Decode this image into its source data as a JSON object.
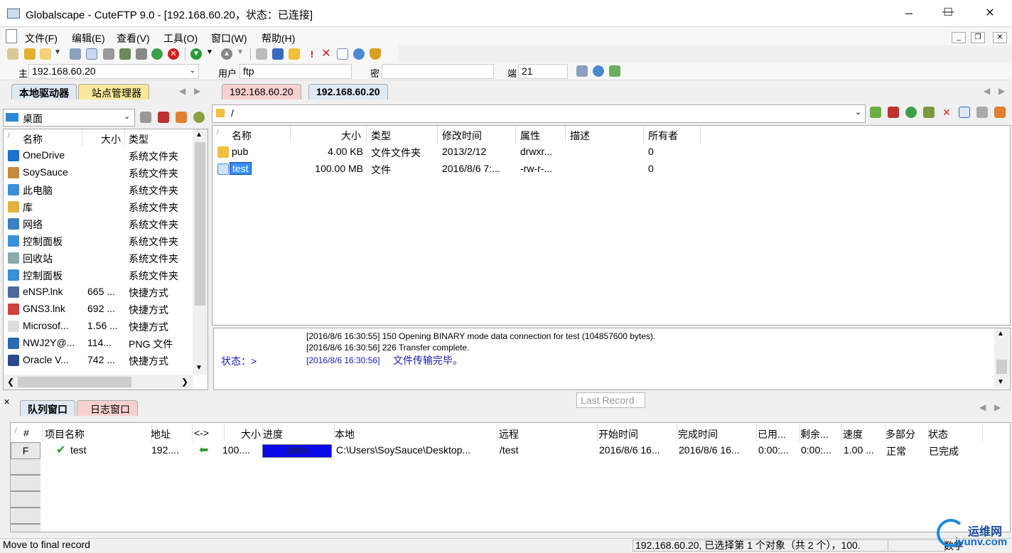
{
  "window": {
    "title": "Globalscape - CuteFTP 9.0 - [192.168.60.20，状态：已连接]"
  },
  "menu": [
    "文件(F)",
    "编辑(E)",
    "查看(V)",
    "工具(O)",
    "窗口(W)",
    "帮助(H)"
  ],
  "quickconnect": {
    "host_label": "主",
    "host": "192.168.60.20",
    "user_label": "用户",
    "user": "ftp",
    "pass_label": "密",
    "pass": "",
    "port_label": "端",
    "port": "21"
  },
  "left_tabs": [
    "本地驱动器",
    "站点管理器"
  ],
  "left_path": "桌面",
  "left_columns": [
    "名称",
    "大小",
    "类型"
  ],
  "left_files": [
    {
      "name": "OneDrive",
      "size": "",
      "type": "系统文件夹",
      "icon": "cloud-icon",
      "color": "#1e6fd0"
    },
    {
      "name": "SoySauce",
      "size": "",
      "type": "系统文件夹",
      "icon": "user-icon",
      "color": "#c58b3a"
    },
    {
      "name": "此电脑",
      "size": "",
      "type": "系统文件夹",
      "icon": "computer-icon",
      "color": "#3a8fd6"
    },
    {
      "name": "库",
      "size": "",
      "type": "系统文件夹",
      "icon": "library-icon",
      "color": "#e2b33c"
    },
    {
      "name": "网络",
      "size": "",
      "type": "系统文件夹",
      "icon": "network-icon",
      "color": "#3a7fc0"
    },
    {
      "name": "控制面板",
      "size": "",
      "type": "系统文件夹",
      "icon": "control-panel-icon",
      "color": "#3a8fd6"
    },
    {
      "name": "回收站",
      "size": "",
      "type": "系统文件夹",
      "icon": "recycle-bin-icon",
      "color": "#8aa"
    },
    {
      "name": "控制面板",
      "size": "",
      "type": "系统文件夹",
      "icon": "control-panel-icon",
      "color": "#3a8fd6"
    },
    {
      "name": "eNSP.lnk",
      "size": "665 ...",
      "type": "快捷方式",
      "icon": "ensp-icon",
      "color": "#4a6a9a"
    },
    {
      "name": "GNS3.lnk",
      "size": "692 ...",
      "type": "快捷方式",
      "icon": "gns3-icon",
      "color": "#d04040"
    },
    {
      "name": "Microsof...",
      "size": "1.56 ...",
      "type": "快捷方式",
      "icon": "document-icon",
      "color": "#ddd"
    },
    {
      "name": "NWJ2Y@...",
      "size": "114...",
      "type": "PNG 文件",
      "icon": "image-icon",
      "color": "#2a6ab0"
    },
    {
      "name": "Oracle V...",
      "size": "742 ...",
      "type": "快捷方式",
      "icon": "virtualbox-icon",
      "color": "#2a4a8a"
    }
  ],
  "remote_tabs": [
    "192.168.60.20",
    "192.168.60.20"
  ],
  "remote_path": "/",
  "remote_columns": [
    "名称",
    "大小",
    "类型",
    "修改时间",
    "属性",
    "描述",
    "所有者"
  ],
  "remote_files": [
    {
      "name": "pub",
      "size": "4.00 KB",
      "type": "文件文件夹",
      "mtime": "2013/2/12",
      "attr": "drwxr...",
      "desc": "",
      "owner": "0",
      "icon": "folder-icon"
    },
    {
      "name": "test",
      "size": "100.00 MB",
      "type": "文件",
      "mtime": "2016/8/6 7:...",
      "attr": "-rw-r-...",
      "desc": "",
      "owner": "0",
      "icon": "file-icon"
    }
  ],
  "log": {
    "status_label": "状态：>",
    "lines": [
      "[2016/8/6 16:30:55] 150 Opening BINARY mode data connection for test (104857600 bytes).",
      "[2016/8/6 16:30:56] 226 Transfer complete."
    ],
    "last_prefix": "[2016/8/6 16:30:56]",
    "last_msg": "文件传输完毕。"
  },
  "tooltip": "Last Record",
  "bottom_tabs": [
    "队列窗口",
    "日志窗口"
  ],
  "queue_columns": [
    "#",
    "项目名称",
    "地址",
    "<->",
    "大小",
    "进度",
    "本地",
    "远程",
    "开始时间",
    "完成时间",
    "已用...",
    "剩余...",
    "速度",
    "多部分",
    "状态"
  ],
  "queue_rows": [
    {
      "flag": "F",
      "name": "test",
      "addr": "192....",
      "size": "100....",
      "progress_pct": 100,
      "progress_text": "100%",
      "local": "C:\\Users\\SoySauce\\Desktop...",
      "remote": "/test",
      "start": "2016/8/6 16...",
      "end": "2016/8/6 16...",
      "elapsed": "0:00:...",
      "remaining": "0:00:...",
      "speed": "1.00 ...",
      "multipart": "正常",
      "status": "已完成"
    }
  ],
  "statusbar": {
    "left": "Move to final record",
    "center": "192.168.60.20, 已选择第 1 个对象（共 2 个），100.",
    "right": "数字"
  },
  "watermark": {
    "text1": "运维网",
    "text2": "iyunv.com"
  }
}
